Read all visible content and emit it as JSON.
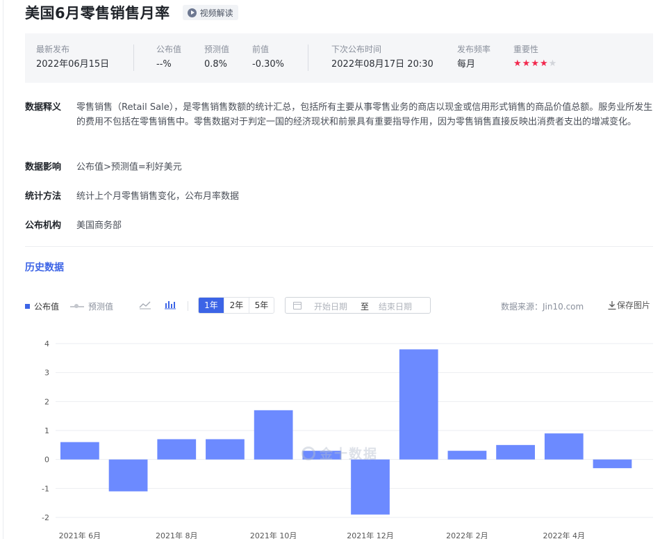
{
  "header": {
    "title": "美国6月零售销售月率",
    "video_label": "视频解读"
  },
  "info": {
    "latest_label": "最新发布",
    "latest_value": "2022年06月15日",
    "actual_label": "公布值",
    "actual_value": "--%",
    "forecast_label": "预测值",
    "forecast_value": "0.8%",
    "previous_label": "前值",
    "previous_value": "-0.30%",
    "next_label": "下次公布时间",
    "next_value": "2022年08月17日 20:30",
    "freq_label": "发布频率",
    "freq_value": "每月",
    "importance_label": "重要性",
    "importance_stars": 4,
    "importance_max": 5
  },
  "details": [
    {
      "key": "数据释义",
      "value": "零售销售（Retail Sale），是零售销售数额的统计汇总，包括所有主要从事零售业务的商店以现金或信用形式销售的商品价值总额。服务业所发生的费用不包括在零售销售中。零售数据对于判定一国的经济现状和前景具有重要指导作用，因为零售销售直接反映出消费者支出的增减变化。"
    },
    {
      "key": "数据影响",
      "value": "公布值>预测值=利好美元"
    },
    {
      "key": "统计方法",
      "value": "统计上个月零售销售变化，公布月率数据"
    },
    {
      "key": "公布机构",
      "value": "美国商务部"
    }
  ],
  "history": {
    "title": "历史数据"
  },
  "toolbar": {
    "legend_published": "公布值",
    "legend_forecast": "预测值",
    "line_icon": "line-chart-icon",
    "bar_icon": "bar-chart-icon",
    "ranges": [
      "1年",
      "2年",
      "5年"
    ],
    "active_range": "1年",
    "date_start_placeholder": "开始日期",
    "date_to": "至",
    "date_end_placeholder": "结束日期",
    "source": "数据来源：Jin10.com",
    "save_label": "保存图片"
  },
  "watermark": "金十数据",
  "colors": {
    "accent": "#3c64e6",
    "bar": "#6c8aff",
    "star": "#f2284d"
  },
  "chart_data": {
    "type": "bar",
    "series": [
      {
        "name": "公布值",
        "values": [
          0.6,
          -1.1,
          0.7,
          0.7,
          1.7,
          0.3,
          -1.9,
          3.8,
          0.3,
          0.5,
          0.9,
          -0.3
        ]
      }
    ],
    "x_tick_labels": [
      "2021年 6月",
      "2021年 8月",
      "2021年 10月",
      "2021年 12月",
      "2022年 2月",
      "2022年 4月"
    ],
    "y_ticks": [
      4,
      3,
      2,
      1,
      0,
      -1,
      -2
    ],
    "ylim": [
      -2,
      4
    ],
    "grid": true
  }
}
